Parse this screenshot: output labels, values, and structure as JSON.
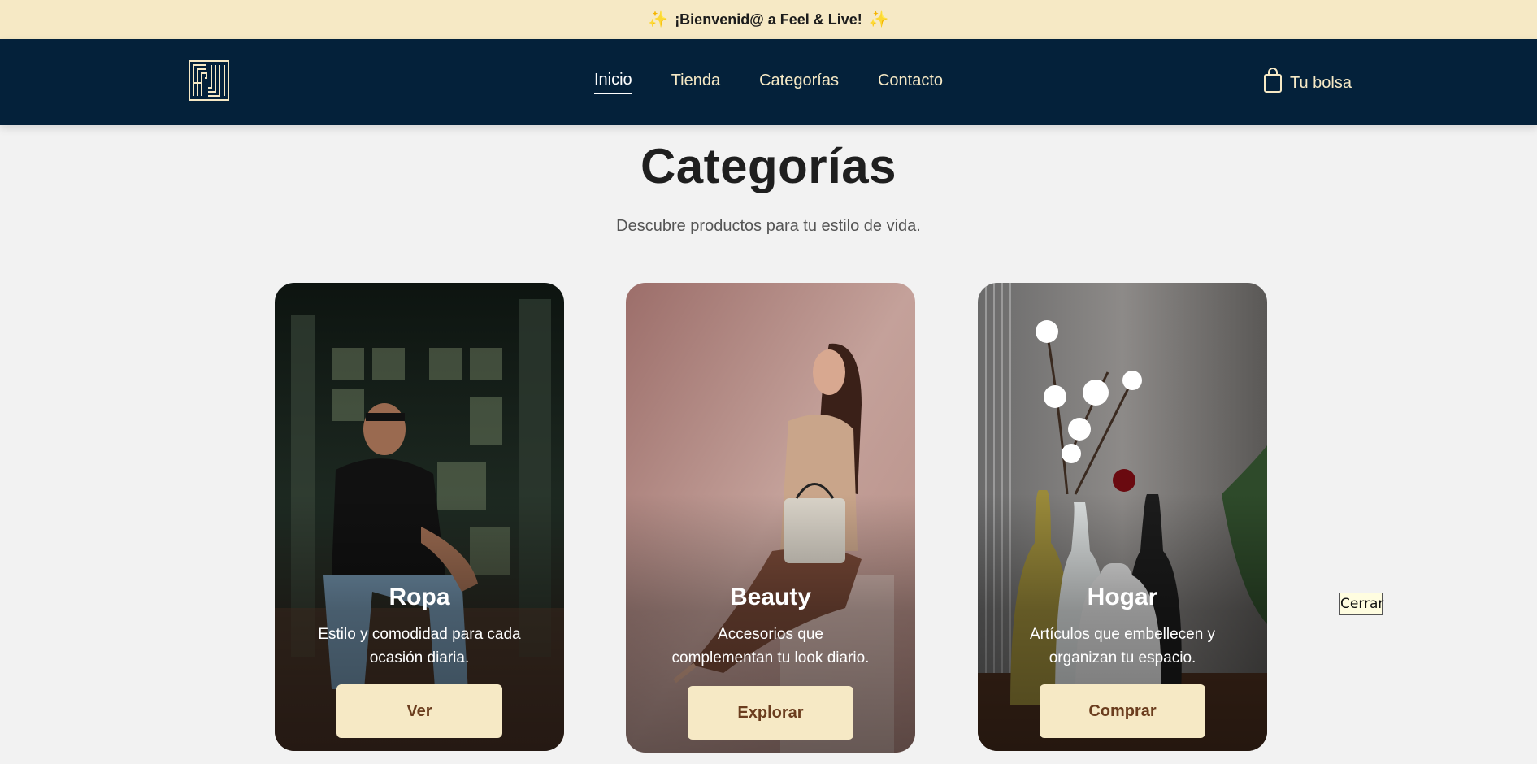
{
  "announcement": {
    "text": "¡Bienvenid@ a Feel & Live!"
  },
  "nav": {
    "logo_alt": "FL logo",
    "links": [
      {
        "label": "Inicio",
        "active": true
      },
      {
        "label": "Tienda",
        "active": false
      },
      {
        "label": "Categorías",
        "active": false
      },
      {
        "label": "Contacto",
        "active": false
      }
    ],
    "cart_label": "Tu bolsa"
  },
  "page": {
    "title": "Categorías",
    "subtitle": "Descubre productos para tu estilo de vida."
  },
  "categories": [
    {
      "title": "Ropa",
      "description": "Estilo y comodidad para cada ocasión diaria.",
      "button": "Ver"
    },
    {
      "title": "Beauty",
      "description": "Accesorios que complementan tu look diario.",
      "button": "Explorar"
    },
    {
      "title": "Hogar",
      "description": "Artículos que embellecen y organizan tu espacio.",
      "button": "Comprar"
    }
  ],
  "close_button": "Cerrar",
  "colors": {
    "announce_bg": "#f6e9c5",
    "navbar_bg": "#04213a",
    "accent_cream": "#f6e9c5",
    "button_text": "#6b3d1e",
    "page_bg": "#f2f2f2"
  },
  "icons": [
    "sparkle-icon",
    "logo-icon",
    "shopping-bag-icon"
  ]
}
